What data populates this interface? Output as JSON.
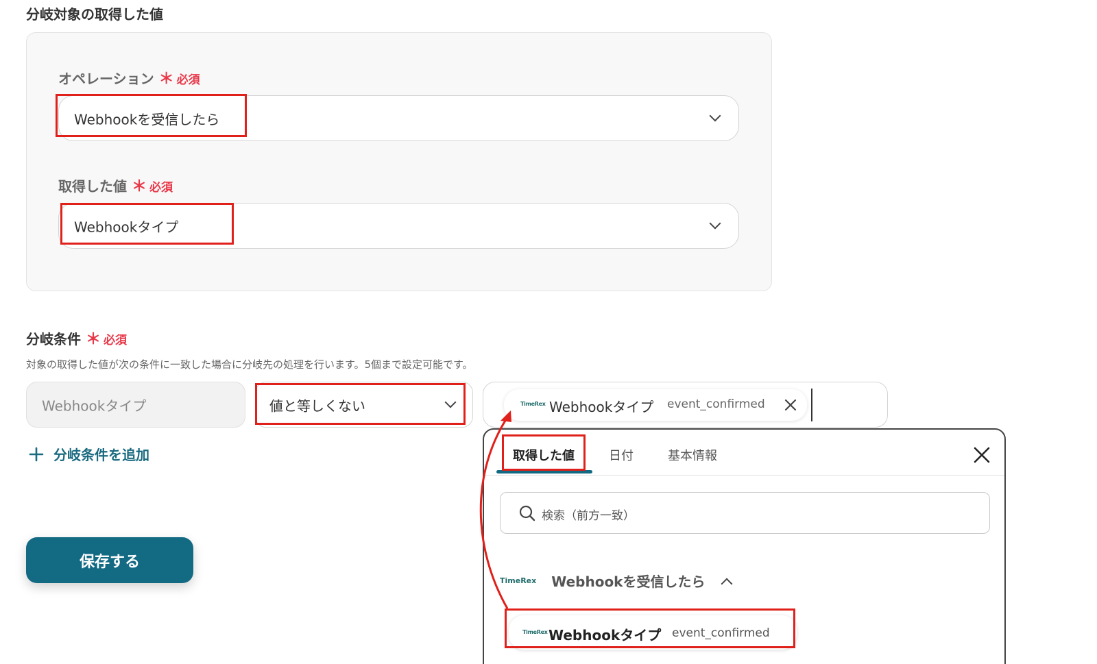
{
  "section": {
    "title": "分岐対象の取得した値"
  },
  "operation": {
    "label": "オペレーション",
    "required_mark": "＊",
    "required_text": "必須",
    "value": "Webhookを受信したら"
  },
  "acquired_value": {
    "label": "取得した値",
    "required_mark": "＊",
    "required_text": "必須",
    "value": "Webhookタイプ"
  },
  "branch_condition": {
    "title": "分岐条件",
    "required_mark": "＊",
    "required_text": "必須",
    "description": "対象の取得した値が次の条件に一致した場合に分岐先の処理を行います。5個まで設定可能です。",
    "field_value": "Webhookタイプ",
    "operator_value": "値と等しくない",
    "chip_logo": "TimeRex",
    "chip_label": "Webhookタイプ",
    "chip_sub": "event_confirmed",
    "add_label": "分岐条件を追加"
  },
  "save_button": {
    "label": "保存する"
  },
  "popup": {
    "tabs": [
      "取得した値",
      "日付",
      "基本情報"
    ],
    "search_placeholder": "検索（前方一致）",
    "group_logo": "TimeRex",
    "group_title": "Webhookを受信したら",
    "result_logo": "TimeRex",
    "result_label": "Webhookタイプ",
    "result_sub": "event_confirmed"
  },
  "colors": {
    "accent": "#136a83",
    "required": "#e8394a",
    "highlight": "#e0201a"
  },
  "icons": {
    "chevron": "chevron-down-icon",
    "close": "close-icon",
    "search": "search-icon",
    "plus": "plus-icon"
  }
}
